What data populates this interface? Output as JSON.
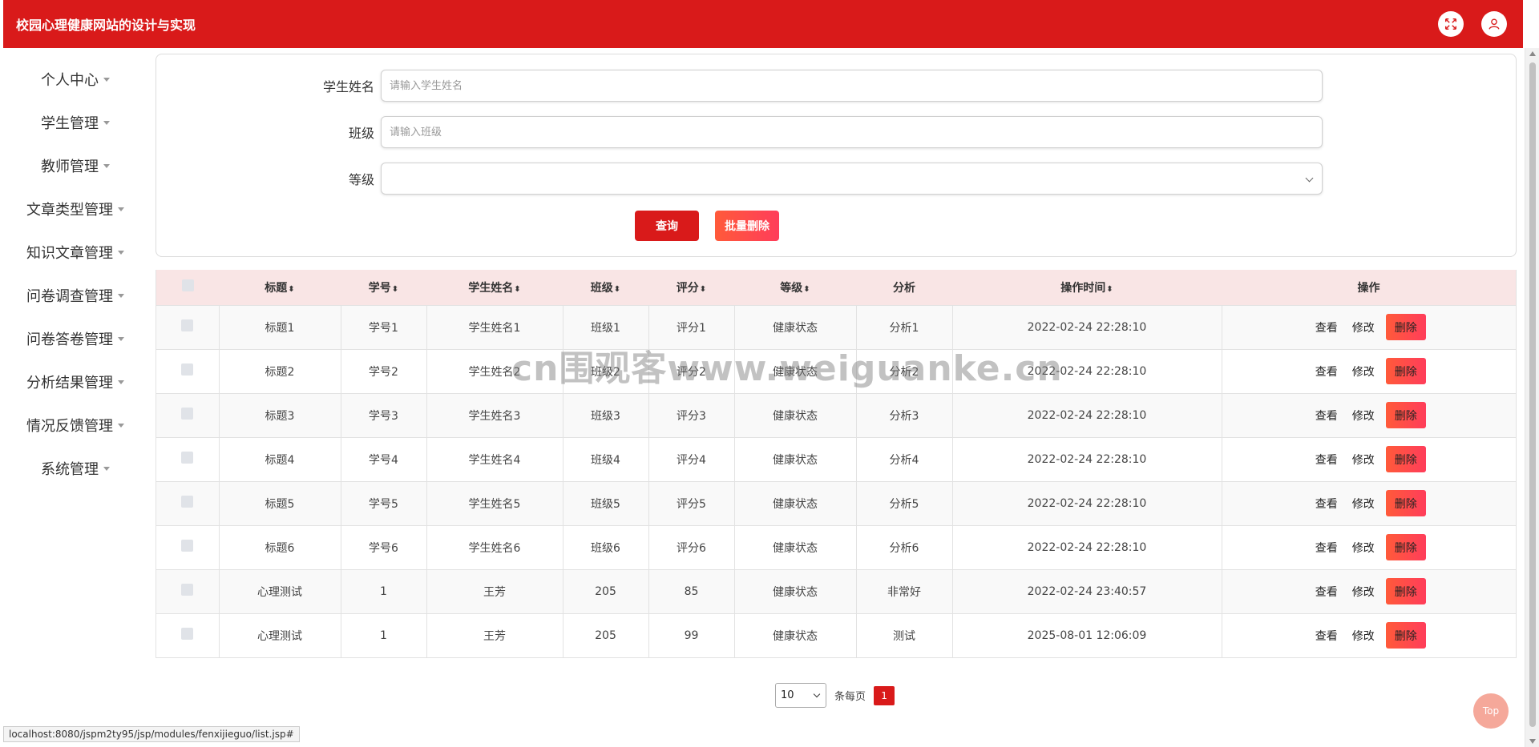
{
  "header": {
    "title": "校园心理健康网站的设计与实现"
  },
  "sidebar": {
    "items": [
      {
        "label": "个人中心"
      },
      {
        "label": "学生管理"
      },
      {
        "label": "教师管理"
      },
      {
        "label": "文章类型管理"
      },
      {
        "label": "知识文章管理"
      },
      {
        "label": "问卷调查管理"
      },
      {
        "label": "问卷答卷管理"
      },
      {
        "label": "分析结果管理"
      },
      {
        "label": "情况反馈管理"
      },
      {
        "label": "系统管理"
      }
    ]
  },
  "search": {
    "student_name_label": "学生姓名",
    "student_name_placeholder": "请输入学生姓名",
    "class_label": "班级",
    "class_placeholder": "请输入班级",
    "level_label": "等级",
    "level_value": "",
    "query_label": "查询",
    "batch_delete_label": "批量删除"
  },
  "table": {
    "headers": [
      "标题",
      "学号",
      "学生姓名",
      "班级",
      "评分",
      "等级",
      "分析",
      "操作时间",
      "操作"
    ],
    "rows": [
      {
        "title": "标题1",
        "student_id": "学号1",
        "name": "学生姓名1",
        "class": "班级1",
        "score": "评分1",
        "level": "健康状态",
        "analysis": "分析1",
        "time": "2022-02-24 22:28:10"
      },
      {
        "title": "标题2",
        "student_id": "学号2",
        "name": "学生姓名2",
        "class": "班级2",
        "score": "评分2",
        "level": "健康状态",
        "analysis": "分析2",
        "time": "2022-02-24 22:28:10"
      },
      {
        "title": "标题3",
        "student_id": "学号3",
        "name": "学生姓名3",
        "class": "班级3",
        "score": "评分3",
        "level": "健康状态",
        "analysis": "分析3",
        "time": "2022-02-24 22:28:10"
      },
      {
        "title": "标题4",
        "student_id": "学号4",
        "name": "学生姓名4",
        "class": "班级4",
        "score": "评分4",
        "level": "健康状态",
        "analysis": "分析4",
        "time": "2022-02-24 22:28:10"
      },
      {
        "title": "标题5",
        "student_id": "学号5",
        "name": "学生姓名5",
        "class": "班级5",
        "score": "评分5",
        "level": "健康状态",
        "analysis": "分析5",
        "time": "2022-02-24 22:28:10"
      },
      {
        "title": "标题6",
        "student_id": "学号6",
        "name": "学生姓名6",
        "class": "班级6",
        "score": "评分6",
        "level": "健康状态",
        "analysis": "分析6",
        "time": "2022-02-24 22:28:10"
      },
      {
        "title": "心理测试",
        "student_id": "1",
        "name": "王芳",
        "class": "205",
        "score": "85",
        "level": "健康状态",
        "analysis": "非常好",
        "time": "2022-02-24 23:40:57"
      },
      {
        "title": "心理测试",
        "student_id": "1",
        "name": "王芳",
        "class": "205",
        "score": "99",
        "level": "健康状态",
        "analysis": "测试",
        "time": "2025-08-01 12:06:09"
      }
    ],
    "actions": {
      "view": "查看",
      "edit": "修改",
      "delete": "删除"
    }
  },
  "pager": {
    "page_size": "10",
    "per_page_text": "条每页",
    "current_page": "1"
  },
  "top_button": "Top",
  "status_url": "localhost:8080/jspm2ty95/jsp/modules/fenxijieguo/list.jsp#",
  "watermark": "cn围观客www.weiguanke.cn",
  "colors": {
    "primary": "#d91a1a",
    "table_header_bg": "#f9e5e5",
    "delete_gradient_start": "#ff5a3a",
    "delete_gradient_end": "#ff3d5a"
  }
}
